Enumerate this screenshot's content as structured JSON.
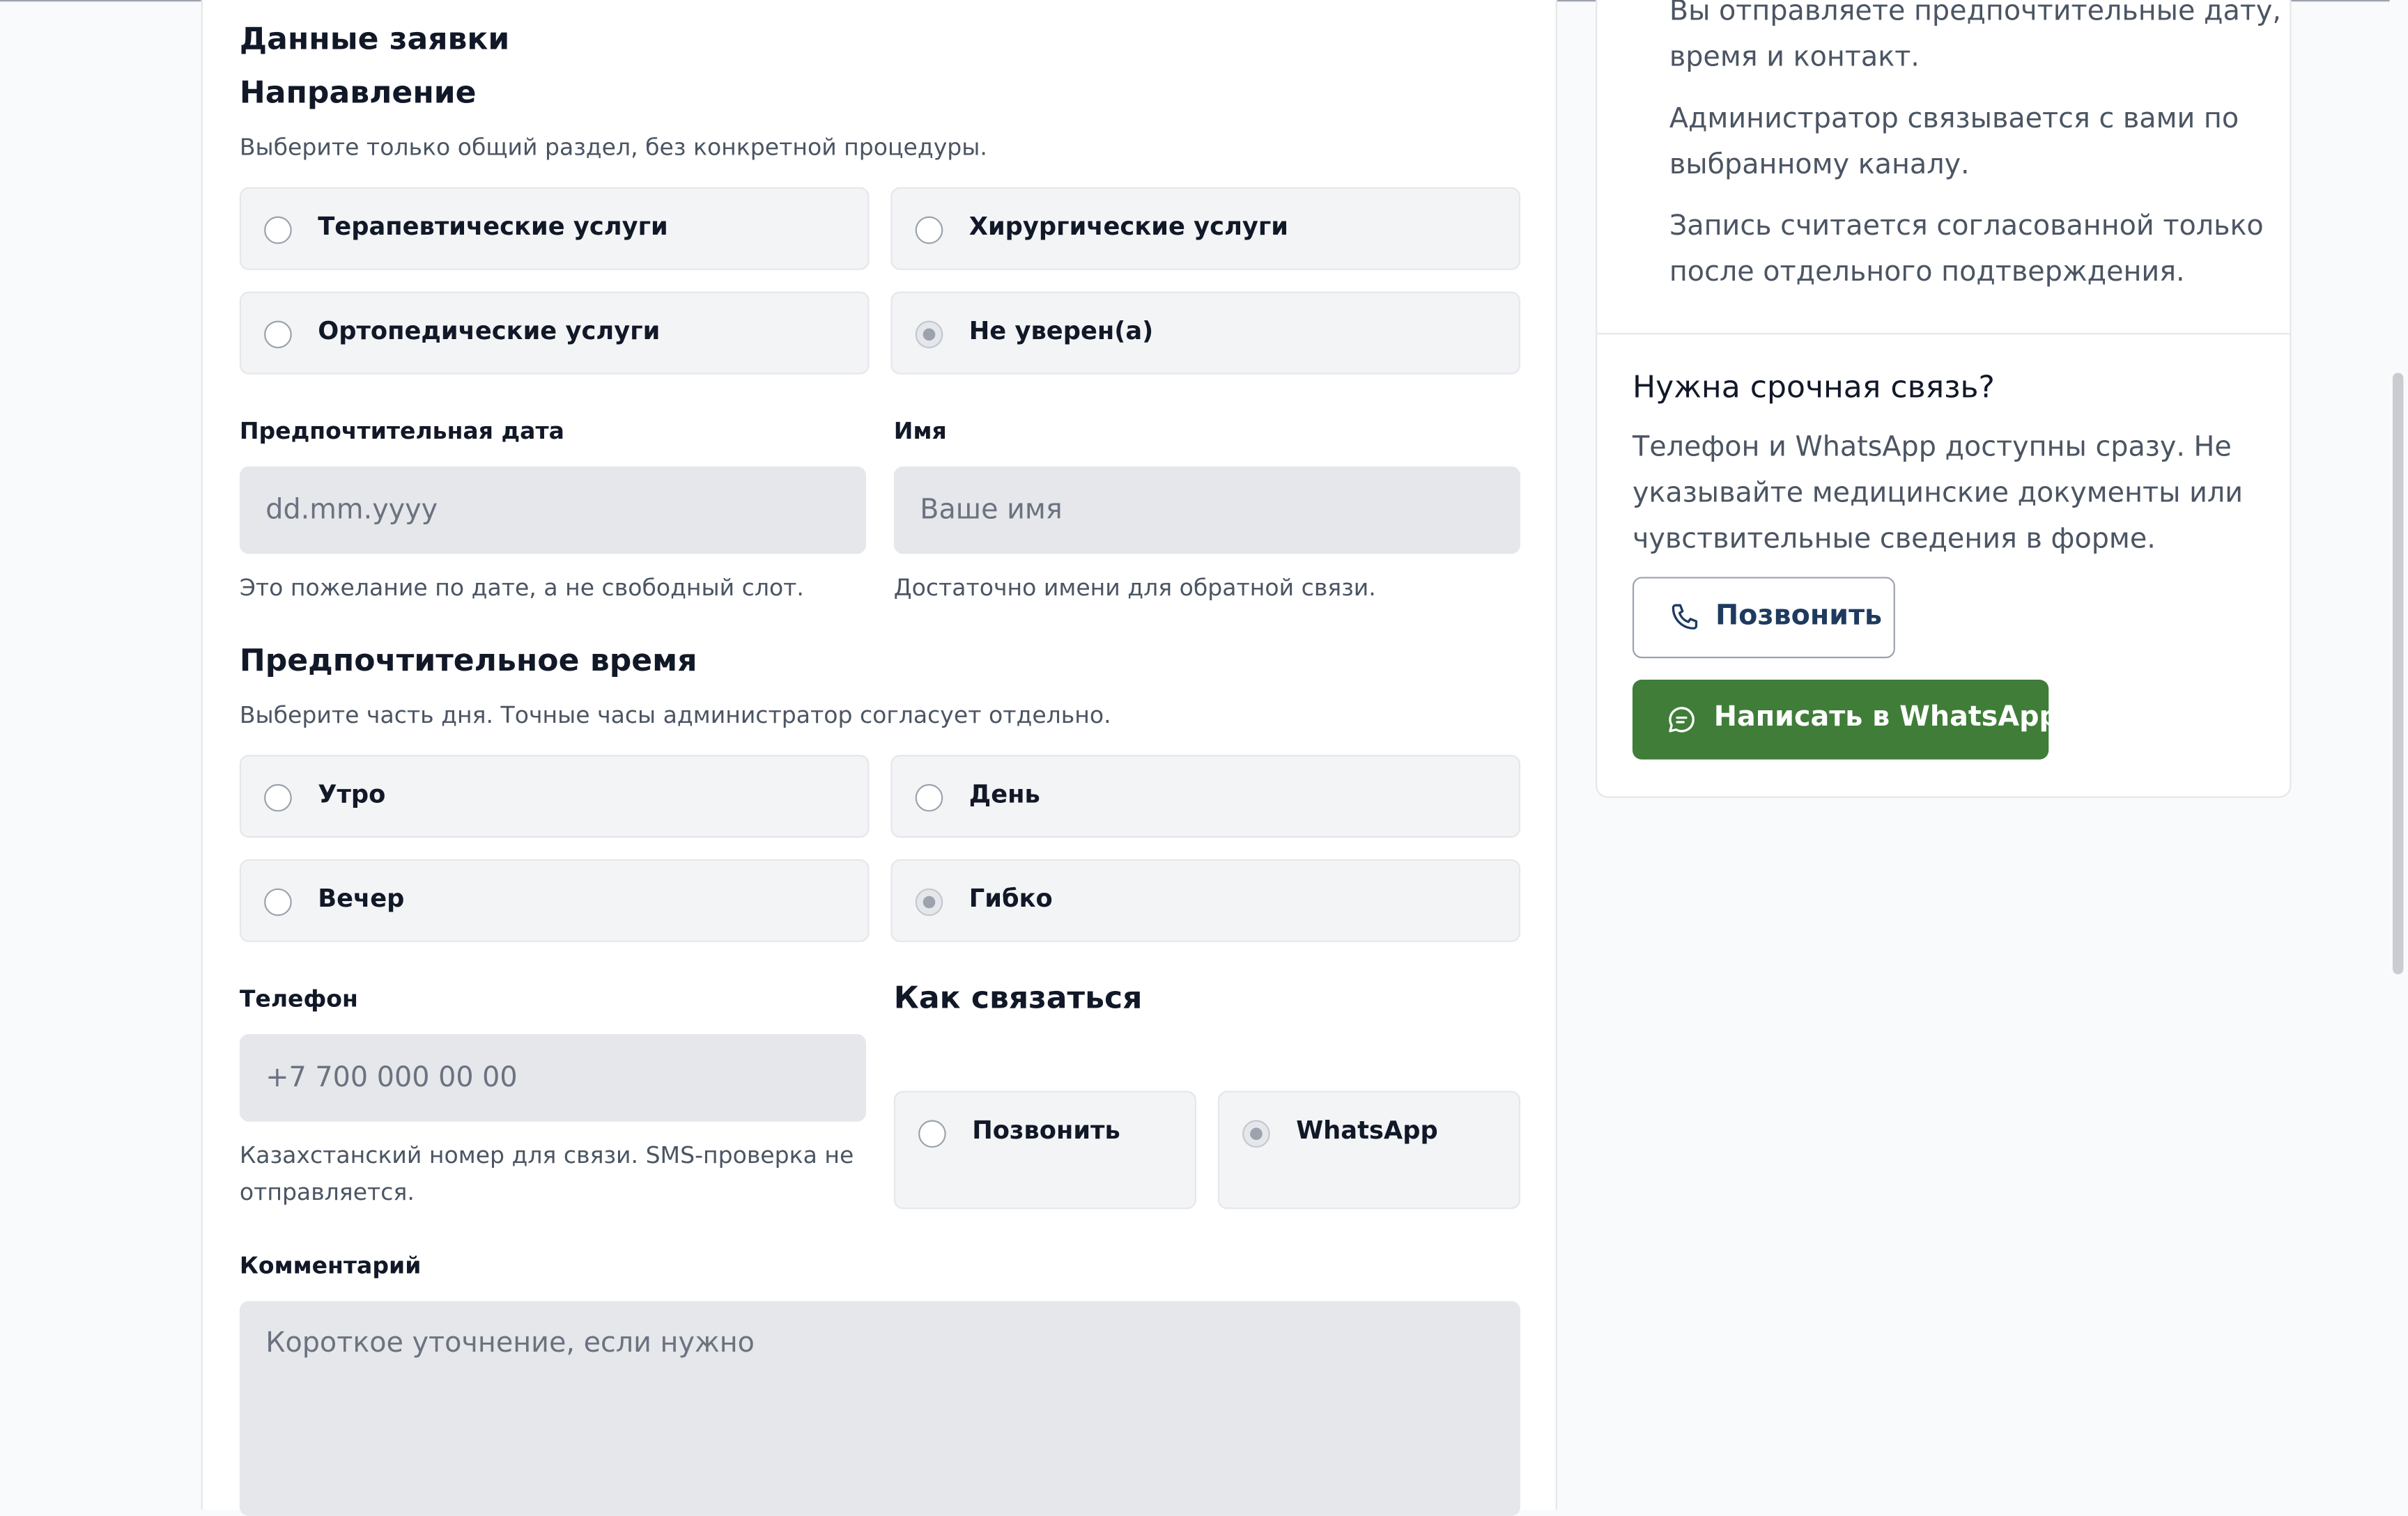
{
  "form": {
    "title": "Данные заявки",
    "direction": {
      "heading": "Направление",
      "helper": "Выберите только общий раздел, без конкретной процедуры.",
      "options": [
        {
          "label": "Терапевтические услуги",
          "checked": false
        },
        {
          "label": "Хирургические услуги",
          "checked": false
        },
        {
          "label": "Ортопедические услуги",
          "checked": false
        },
        {
          "label": "Не уверен(а)",
          "checked": true
        }
      ]
    },
    "date": {
      "label": "Предпочтительная дата",
      "placeholder": "dd.mm.yyyy",
      "helper": "Это пожелание по дате, а не свободный слот."
    },
    "name": {
      "label": "Имя",
      "placeholder": "Ваше имя",
      "helper": "Достаточно имени для обратной связи."
    },
    "time": {
      "heading": "Предпочтительное время",
      "helper": "Выберите часть дня. Точные часы администратор согласует отдельно.",
      "options": [
        {
          "label": "Утро",
          "checked": false
        },
        {
          "label": "День",
          "checked": false
        },
        {
          "label": "Вечер",
          "checked": false
        },
        {
          "label": "Гибко",
          "checked": true
        }
      ]
    },
    "phone": {
      "label": "Телефон",
      "placeholder": "+7 700 000 00 00",
      "helper_line1": "Казахстанский номер для связи. SMS-проверка не",
      "helper_line2": "отправляется."
    },
    "contact": {
      "heading": "Как связаться",
      "options": [
        {
          "label": "Позвонить",
          "checked": false
        },
        {
          "label": "WhatsApp",
          "checked": true
        }
      ]
    },
    "comment": {
      "label": "Комментарий",
      "placeholder": "Короткое уточнение, если нужно"
    }
  },
  "sidebar": {
    "steps": {
      "line1": "Вы отправляете предпочтительные дату,",
      "line2": "время и контакт.",
      "line3": "Администратор связывается с вами по",
      "line4": "выбранному каналу.",
      "line5": "Запись считается согласованной только",
      "line6": "после отдельного подтверждения."
    },
    "urgent": {
      "heading": "Нужна срочная связь?",
      "line1": "Телефон и WhatsApp доступны сразу. Не",
      "line2": "указывайте медицинские документы или",
      "line3": "чувствительные сведения в форме.",
      "call_label": "Позвонить",
      "whatsapp_label": "Написать в WhatsApp"
    }
  },
  "colors": {
    "whatsapp_button": "#3f7d38",
    "call_button_text": "#1e3a5f",
    "input_bg": "#e5e7eb",
    "option_bg": "#f3f4f6"
  }
}
